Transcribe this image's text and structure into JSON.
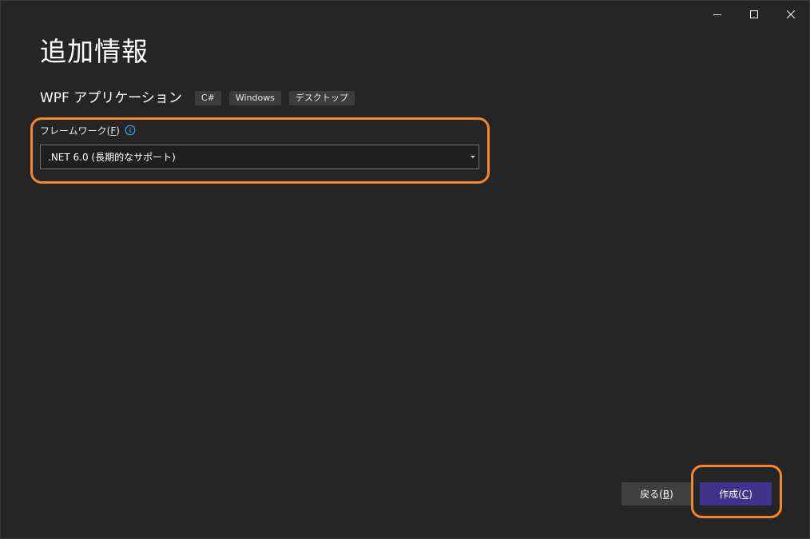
{
  "window": {
    "controls": {
      "minimize_icon": "minimize-icon",
      "maximize_icon": "maximize-icon",
      "close_icon": "close-icon"
    }
  },
  "page": {
    "title": "追加情報"
  },
  "template": {
    "name": "WPF アプリケーション",
    "tags": [
      "C#",
      "Windows",
      "デスクトップ"
    ]
  },
  "framework": {
    "label": "フレームワーク(",
    "label_key": "F",
    "label_end": ")",
    "info_icon": "info-icon",
    "selected": ".NET 6.0 (長期的なサポート)"
  },
  "footer": {
    "back_label": "戻る(",
    "back_key": "B",
    "back_end": ")",
    "create_label": "作成(",
    "create_key": "C",
    "create_end": ")"
  },
  "colors": {
    "background": "#252526",
    "accent_button": "#40318a",
    "highlight": "#f7852a",
    "info_blue": "#3aa0f3"
  }
}
